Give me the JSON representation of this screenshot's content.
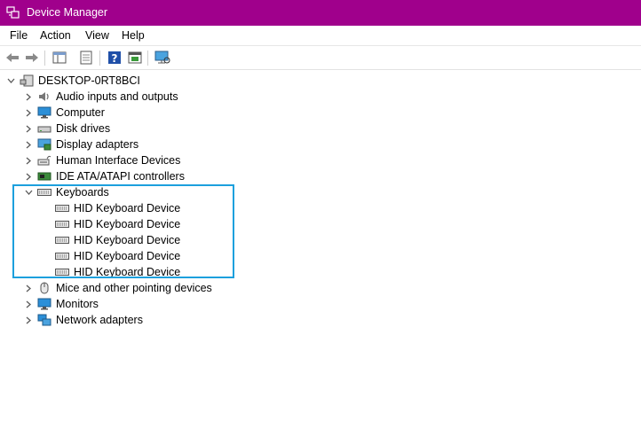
{
  "window": {
    "title": "Device Manager"
  },
  "menu": {
    "items": [
      "File",
      "Action",
      "View",
      "Help"
    ]
  },
  "toolbar": {
    "buttons": [
      "back-icon",
      "forward-icon",
      "show-hide-tree-icon",
      "properties-icon",
      "help-icon",
      "update-driver-icon",
      "scan-hardware-icon"
    ]
  },
  "tree": {
    "root": {
      "label": "DESKTOP-0RT8BCI",
      "icon": "computer-icon"
    },
    "categories": [
      {
        "label": "Audio inputs and outputs",
        "icon": "audio-icon",
        "expanded": false
      },
      {
        "label": "Computer",
        "icon": "computer-icon",
        "expanded": false
      },
      {
        "label": "Disk drives",
        "icon": "disk-drive-icon",
        "expanded": false
      },
      {
        "label": "Display adapters",
        "icon": "display-adapter-icon",
        "expanded": false
      },
      {
        "label": "Human Interface Devices",
        "icon": "hid-icon",
        "expanded": false
      },
      {
        "label": "IDE ATA/ATAPI controllers",
        "icon": "ide-controller-icon",
        "expanded": false
      },
      {
        "label": "Keyboards",
        "icon": "keyboard-icon",
        "expanded": true,
        "children": [
          "HID Keyboard Device",
          "HID Keyboard Device",
          "HID Keyboard Device",
          "HID Keyboard Device",
          "HID Keyboard Device"
        ]
      },
      {
        "label": "Mice and other pointing devices",
        "icon": "mouse-icon",
        "expanded": false
      },
      {
        "label": "Monitors",
        "icon": "monitor-icon",
        "expanded": false
      },
      {
        "label": "Network adapters",
        "icon": "network-adapter-icon",
        "expanded": false
      }
    ]
  },
  "colors": {
    "titlebar": "#a0008c",
    "highlight": "#1ca0dd"
  }
}
